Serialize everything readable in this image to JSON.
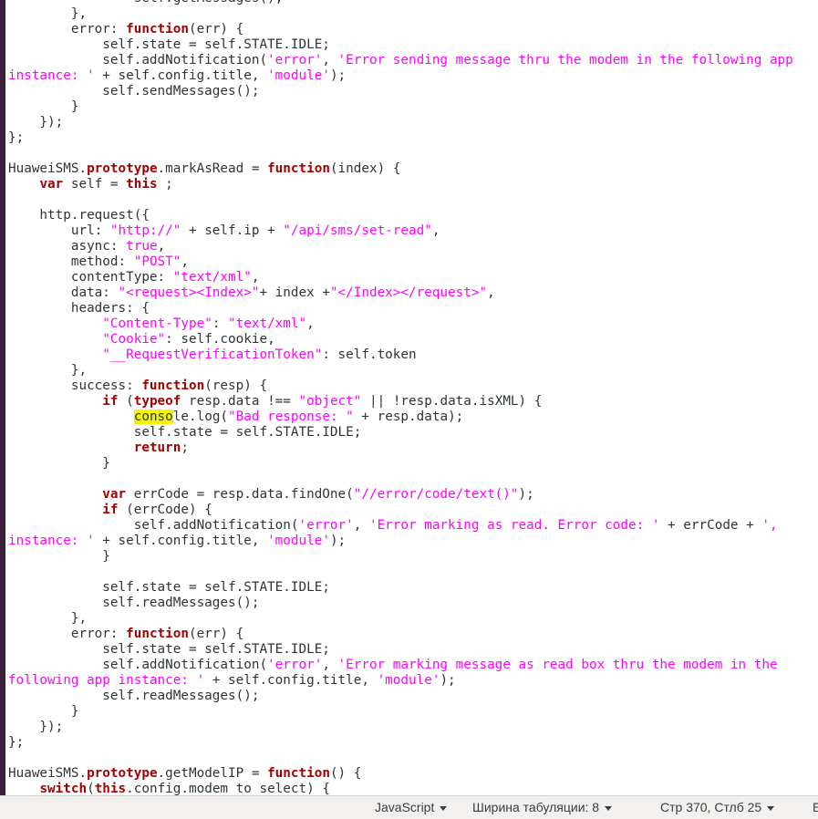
{
  "code_lines": [
    [
      [
        "nm",
        "                self.getMessages();"
      ]
    ],
    [
      [
        "nm",
        "        },"
      ]
    ],
    [
      [
        "nm",
        "        error: "
      ],
      [
        "kw",
        "function"
      ],
      [
        "nm",
        "(err) {"
      ]
    ],
    [
      [
        "nm",
        "            self.state = self.STATE.IDLE;"
      ]
    ],
    [
      [
        "nm",
        "            self.addNotification("
      ],
      [
        "st",
        "'error'"
      ],
      [
        "nm",
        ", "
      ],
      [
        "st",
        "'Error sending message thru the modem in the following app"
      ]
    ],
    [
      [
        "st",
        "instance: '"
      ],
      [
        "nm",
        " + self.config.title, "
      ],
      [
        "st",
        "'module'"
      ],
      [
        "nm",
        ");"
      ]
    ],
    [
      [
        "nm",
        "            self.sendMessages();"
      ]
    ],
    [
      [
        "nm",
        "        }"
      ]
    ],
    [
      [
        "nm",
        "    });"
      ]
    ],
    [
      [
        "nm",
        "};"
      ]
    ],
    [
      [
        "nm",
        ""
      ]
    ],
    [
      [
        "nm",
        "HuaweiSMS."
      ],
      [
        "kw",
        "prototype"
      ],
      [
        "nm",
        ".markAsRead = "
      ],
      [
        "kw",
        "function"
      ],
      [
        "nm",
        "(index) {"
      ]
    ],
    [
      [
        "nm",
        "    "
      ],
      [
        "kw",
        "var"
      ],
      [
        "nm",
        " self = "
      ],
      [
        "kw",
        "this"
      ],
      [
        "nm",
        " ;"
      ]
    ],
    [
      [
        "nm",
        ""
      ]
    ],
    [
      [
        "nm",
        "    http.request({"
      ]
    ],
    [
      [
        "nm",
        "        url: "
      ],
      [
        "st",
        "\"http://\""
      ],
      [
        "nm",
        " + self.ip + "
      ],
      [
        "st",
        "\"/api/sms/set-read\""
      ],
      [
        "nm",
        ","
      ]
    ],
    [
      [
        "nm",
        "        async: "
      ],
      [
        "st",
        "true"
      ],
      [
        "nm",
        ","
      ]
    ],
    [
      [
        "nm",
        "        method: "
      ],
      [
        "st",
        "\"POST\""
      ],
      [
        "nm",
        ","
      ]
    ],
    [
      [
        "nm",
        "        contentType: "
      ],
      [
        "st",
        "\"text/xml\""
      ],
      [
        "nm",
        ","
      ]
    ],
    [
      [
        "nm",
        "        data: "
      ],
      [
        "st",
        "\"<request><Index>\""
      ],
      [
        "nm",
        "+ index +"
      ],
      [
        "st",
        "\"</Index></request>\""
      ],
      [
        "nm",
        ","
      ]
    ],
    [
      [
        "nm",
        "        headers: {"
      ]
    ],
    [
      [
        "nm",
        "            "
      ],
      [
        "st",
        "\"Content-Type\""
      ],
      [
        "nm",
        ": "
      ],
      [
        "st",
        "\"text/xml\""
      ],
      [
        "nm",
        ","
      ]
    ],
    [
      [
        "nm",
        "            "
      ],
      [
        "st",
        "\"Cookie\""
      ],
      [
        "nm",
        ": self.cookie,"
      ]
    ],
    [
      [
        "nm",
        "            "
      ],
      [
        "st",
        "\"__RequestVerificationToken\""
      ],
      [
        "nm",
        ": self.token"
      ]
    ],
    [
      [
        "nm",
        "        },"
      ]
    ],
    [
      [
        "nm",
        "        success: "
      ],
      [
        "kw",
        "function"
      ],
      [
        "nm",
        "(resp) {"
      ]
    ],
    [
      [
        "nm",
        "            "
      ],
      [
        "kw",
        "if"
      ],
      [
        "nm",
        " ("
      ],
      [
        "kw",
        "typeof"
      ],
      [
        "nm",
        " resp.data !== "
      ],
      [
        "st",
        "\"object\""
      ],
      [
        "nm",
        " || !resp.data.isXML) {"
      ]
    ],
    [
      [
        "nm",
        "                "
      ],
      [
        "hl",
        "conso"
      ],
      [
        "nm",
        "le.log("
      ],
      [
        "st",
        "\"Bad response: \""
      ],
      [
        "nm",
        " + resp.data);"
      ]
    ],
    [
      [
        "nm",
        "                self.state = self.STATE.IDLE;"
      ]
    ],
    [
      [
        "nm",
        "                "
      ],
      [
        "kw",
        "return"
      ],
      [
        "nm",
        ";"
      ]
    ],
    [
      [
        "nm",
        "            }"
      ]
    ],
    [
      [
        "nm",
        ""
      ]
    ],
    [
      [
        "nm",
        "            "
      ],
      [
        "kw",
        "var"
      ],
      [
        "nm",
        " errCode = resp.data.findOne("
      ],
      [
        "st",
        "\"//error/code/text()\""
      ],
      [
        "nm",
        ");"
      ]
    ],
    [
      [
        "nm",
        "            "
      ],
      [
        "kw",
        "if"
      ],
      [
        "nm",
        " (errCode) {"
      ]
    ],
    [
      [
        "nm",
        "                self.addNotification("
      ],
      [
        "st",
        "'error'"
      ],
      [
        "nm",
        ", "
      ],
      [
        "st",
        "'Error marking as read. Error code: '"
      ],
      [
        "nm",
        " + errCode + "
      ],
      [
        "st",
        "',"
      ]
    ],
    [
      [
        "st",
        "instance: '"
      ],
      [
        "nm",
        " + self.config.title, "
      ],
      [
        "st",
        "'module'"
      ],
      [
        "nm",
        ");"
      ]
    ],
    [
      [
        "nm",
        "            }"
      ]
    ],
    [
      [
        "nm",
        ""
      ]
    ],
    [
      [
        "nm",
        "            self.state = self.STATE.IDLE;"
      ]
    ],
    [
      [
        "nm",
        "            self.readMessages();"
      ]
    ],
    [
      [
        "nm",
        "        },"
      ]
    ],
    [
      [
        "nm",
        "        error: "
      ],
      [
        "kw",
        "function"
      ],
      [
        "nm",
        "(err) {"
      ]
    ],
    [
      [
        "nm",
        "            self.state = self.STATE.IDLE;"
      ]
    ],
    [
      [
        "nm",
        "            self.addNotification("
      ],
      [
        "st",
        "'error'"
      ],
      [
        "nm",
        ", "
      ],
      [
        "st",
        "'Error marking message as read box thru the modem in the"
      ]
    ],
    [
      [
        "st",
        "following app instance: '"
      ],
      [
        "nm",
        " + self.config.title, "
      ],
      [
        "st",
        "'module'"
      ],
      [
        "nm",
        ");"
      ]
    ],
    [
      [
        "nm",
        "            self.readMessages();"
      ]
    ],
    [
      [
        "nm",
        "        }"
      ]
    ],
    [
      [
        "nm",
        "    });"
      ]
    ],
    [
      [
        "nm",
        "};"
      ]
    ],
    [
      [
        "nm",
        ""
      ]
    ],
    [
      [
        "nm",
        "HuaweiSMS."
      ],
      [
        "kw",
        "prototype"
      ],
      [
        "nm",
        ".getModelIP = "
      ],
      [
        "kw",
        "function"
      ],
      [
        "nm",
        "() {"
      ]
    ],
    [
      [
        "nm",
        "    "
      ],
      [
        "kw",
        "switch"
      ],
      [
        "nm",
        "("
      ],
      [
        "kw",
        "this"
      ],
      [
        "nm",
        ".config.modem_to_select) {"
      ]
    ]
  ],
  "statusbar": {
    "language": "JavaScript",
    "tab_width": "Ширина табуляции: 8",
    "cursor_pos": "Стр 370, Стлб 25",
    "edge_fragment": "E"
  },
  "colors": {
    "keyword": "#a40000",
    "string": "#ff00ff",
    "text": "#2e3436",
    "search_highlight": "#f5f500",
    "left_bar": "#3c1f3a"
  }
}
